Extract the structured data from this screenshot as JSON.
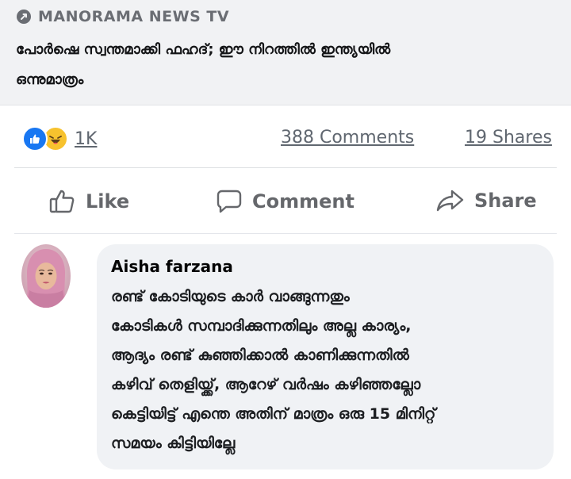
{
  "post": {
    "source": {
      "icon": "link-icon",
      "name": "MANORAMA NEWS TV"
    },
    "headline_lines": [
      "പോർഷെ സ്വന്തമാക്കി ഫഹദ്; ഈ നിറത്തിൽ ഇന്ത്യയിൽ",
      "ഒന്നുമാത്രം"
    ],
    "reactions": {
      "icons": [
        "like-reaction-icon",
        "haha-reaction-icon"
      ],
      "count": "1K"
    },
    "comments_count": "388 Comments",
    "shares_count": "19 Shares"
  },
  "actions": {
    "like_label": "Like",
    "comment_label": "Comment",
    "share_label": "Share"
  },
  "comment": {
    "author": "Aisha farzana",
    "lines": [
      "രണ്ട് കോടിയുടെ കാർ വാങ്ങുന്നതും",
      "കോടികൾ സമ്പാദിക്കുന്നതിലും അല്ല കാര്യം,",
      "ആദ്യം രണ്ട് കുഞ്ഞിക്കാൽ കാണിക്കുന്നതിൽ",
      "കഴിവ് തെളിയ്ക്ക്, ആറേഴ് വർഷം കഴിഞ്ഞല്ലോ",
      "കെട്ടിയിട്ട് എന്തെ അതിന് മാത്രം ഒരു 15 മിനിറ്റ്",
      "സമയം കിട്ടിയില്ലേ"
    ]
  },
  "colors": {
    "accent": "#1877f2",
    "haha": "#f7c22e",
    "muted_text": "#65676b",
    "bubble": "#f0f2f5"
  }
}
